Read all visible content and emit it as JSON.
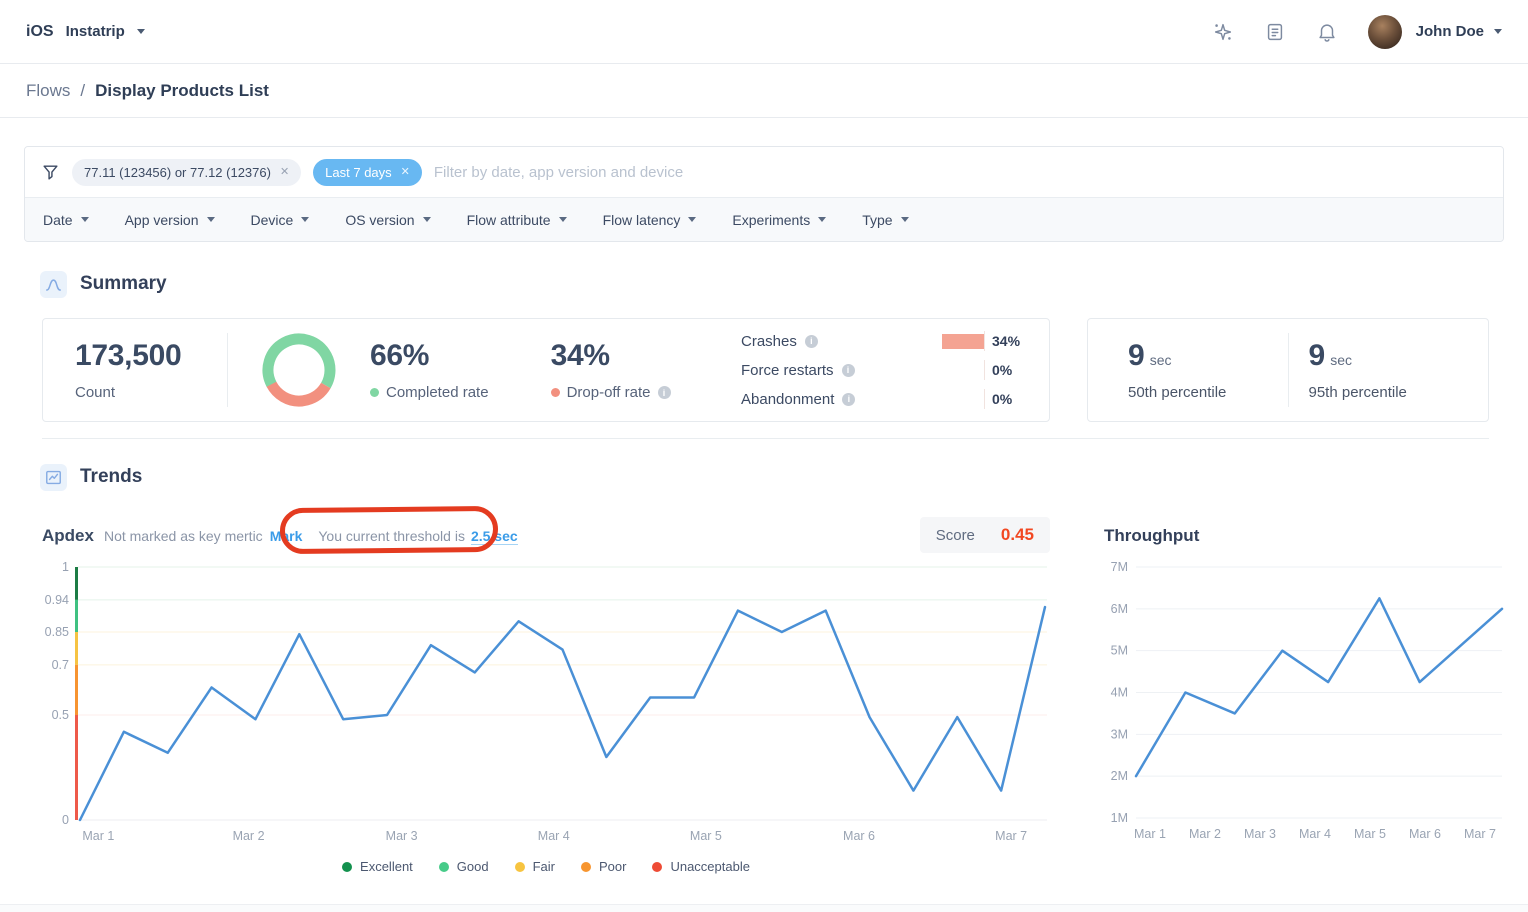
{
  "topbar": {
    "platform": "iOS",
    "app_name": "Instatrip",
    "user_name": "John Doe"
  },
  "breadcrumb": {
    "parent": "Flows",
    "separator": "/",
    "current": "Display Products List"
  },
  "filter_bar": {
    "chip_versions": "77.11 (123456) or 77.12 (12376)",
    "chip_versions_close": "✕",
    "chip_date": "Last 7 days",
    "chip_date_close": "✕",
    "placeholder": "Filter by date, app version and device",
    "dropdowns": [
      "Date",
      "App version",
      "Device",
      "OS version",
      "Flow attribute",
      "Flow latency",
      "Experiments",
      "Type"
    ]
  },
  "summary": {
    "title": "Summary",
    "count_value": "173,500",
    "count_label": "Count",
    "completed_pct": "66%",
    "completed_label": "Completed rate",
    "dropoff_pct": "34%",
    "dropoff_label": "Drop-off rate",
    "donut": {
      "completed_color": "#80d6a3",
      "dropoff_color": "#f2907f",
      "completed_fraction": 0.66
    },
    "crash_rows": [
      {
        "label": "Crashes",
        "value": "34%",
        "has_bar": true
      },
      {
        "label": "Force restarts",
        "value": "0%",
        "has_bar": false
      },
      {
        "label": "Abandonment",
        "value": "0%",
        "has_bar": false
      }
    ],
    "p50_value": "9",
    "p50_unit": "sec",
    "p50_label": "50th percentile",
    "p95_value": "9",
    "p95_unit": "sec",
    "p95_label": "95th percentile"
  },
  "trends": {
    "title": "Trends",
    "apdex_title": "Apdex",
    "apdex_note": "Not marked as key mertic",
    "apdex_link": "Mark",
    "threshold_text": "You current threshold is",
    "threshold_value": "2.5 sec",
    "score_label": "Score",
    "score_value": "0.45",
    "throughput_title": "Throughput"
  },
  "chart_data": [
    {
      "id": "apdex",
      "type": "line",
      "title": "Apdex",
      "line_color": "#4a90d6",
      "x_labels": [
        "Mar 1",
        "Mar 2",
        "Mar 3",
        "Mar 4",
        "Mar 5",
        "Mar 6",
        "Mar 7"
      ],
      "x_label_fractions": [
        0.021,
        0.176,
        0.334,
        0.491,
        0.648,
        0.806,
        0.963
      ],
      "y_ticks": [
        {
          "label": "1",
          "value": 1,
          "grid_color": "#e4f3ea"
        },
        {
          "label": "0.94",
          "value": 0.94,
          "grid_color": "#e4f3ea"
        },
        {
          "label": "0.85",
          "value": 0.85,
          "grid_color": "#fcf3dc"
        },
        {
          "label": "0.7",
          "value": 0.7,
          "grid_color": "#fcf3dc"
        },
        {
          "label": "0.5",
          "value": 0.5,
          "grid_color": "#fdeceb"
        },
        {
          "label": "0",
          "value": 0,
          "grid_color": "#eceef2"
        }
      ],
      "y_anchors": [
        [
          0,
          1
        ],
        [
          0.5,
          0.585
        ],
        [
          0.7,
          0.387
        ],
        [
          0.85,
          0.257
        ],
        [
          0.94,
          0.13
        ],
        [
          1,
          0
        ]
      ],
      "axis_bands": [
        {
          "from": 0.94,
          "to": 1,
          "color": "#1c7c45"
        },
        {
          "from": 0.85,
          "to": 0.94,
          "color": "#3fc181"
        },
        {
          "from": 0.7,
          "to": 0.85,
          "color": "#f6c343"
        },
        {
          "from": 0.5,
          "to": 0.7,
          "color": "#f79431"
        },
        {
          "from": 0,
          "to": 0.5,
          "color": "#ee5a4a"
        }
      ],
      "values": [
        0,
        0.42,
        0.32,
        0.61,
        0.48,
        0.84,
        0.48,
        0.5,
        0.79,
        0.67,
        0.88,
        0.77,
        0.3,
        0.57,
        0.57,
        0.91,
        0.85,
        0.91,
        0.49,
        0.14,
        0.49,
        0.14,
        0.92
      ],
      "score": "0.45",
      "legend": [
        {
          "label": "Excellent",
          "color": "#13914e"
        },
        {
          "label": "Good",
          "color": "#47cb89"
        },
        {
          "label": "Fair",
          "color": "#f7c440"
        },
        {
          "label": "Poor",
          "color": "#f7952f"
        },
        {
          "label": "Unacceptable",
          "color": "#ee4b35"
        }
      ]
    },
    {
      "id": "throughput",
      "type": "line",
      "title": "Throughput",
      "line_color": "#4a90d6",
      "x_labels": [
        "Mar 1",
        "Mar 2",
        "Mar 3",
        "Mar 4",
        "Mar 5",
        "Mar 6",
        "Mar 7"
      ],
      "y_tick_labels": [
        "7M",
        "6M",
        "5M",
        "4M",
        "3M",
        "2M",
        "1M"
      ],
      "ylim_millions": [
        1,
        7
      ],
      "values_millions": [
        2,
        4,
        3.5,
        5,
        4.25,
        6.25,
        4.25,
        6
      ],
      "x_fractions": [
        0,
        0.135,
        0.27,
        0.4,
        0.525,
        0.665,
        0.775,
        1
      ],
      "grid_color": "#eef1f4"
    }
  ]
}
